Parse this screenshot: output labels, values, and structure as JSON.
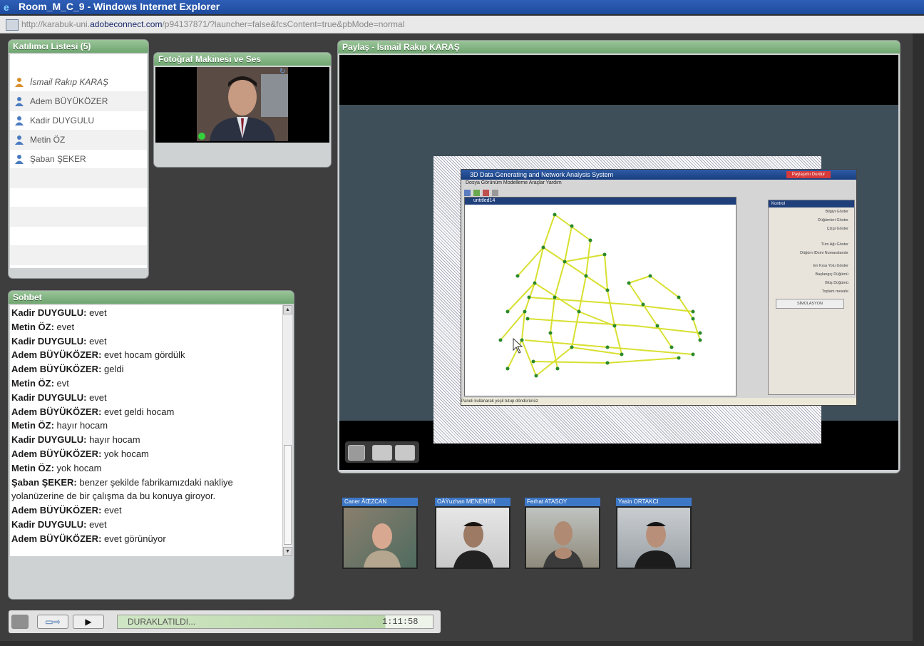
{
  "window": {
    "title": "Room_M_C_9 - Windows Internet Explorer",
    "url_prefix": "http://karabuk-uni.",
    "url_domain": "adobeconnect.com",
    "url_suffix": "/p94137871/?launcher=false&fcsContent=true&pbMode=normal"
  },
  "attendees": {
    "title": "Katılımcı Listesi (5)",
    "items": [
      {
        "name": "İsmail Rakıp KARAŞ"
      },
      {
        "name": "Adem BÜYÜKÖZER"
      },
      {
        "name": "Kadir DUYGULU"
      },
      {
        "name": "Metin ÖZ"
      },
      {
        "name": "Şaban ŞEKER"
      }
    ]
  },
  "camera": {
    "title": "Fotoğraf Makinesi ve Ses"
  },
  "share": {
    "title": "Paylaş - İsmail Rakıp KARAŞ",
    "app_title": "3D Data Generating and Network Analysis System",
    "app_menu": "Dosya  Görünüm  Modelleme  Araçlar  Yardım",
    "inner_title": "untitled14",
    "status": "Paneli kullanarak yeşil tutup döndürünüz",
    "panel_title": "Kontrol",
    "panel_items": [
      "Bilgiyi Göster",
      "Düğümleri Göster",
      "Çizgi Göster",
      "Tüm Ağı Göster",
      "Düğüm IDsini Numaralandır",
      "En Kısa Yolu Göster",
      "Başlangıç Düğümü",
      "Bitiş Düğümü",
      "Toplam mesafe",
      "SİMÜLASYON"
    ],
    "share_badge": "Paylaşımı Durdur"
  },
  "chat": {
    "title": "Sohbet",
    "messages": [
      {
        "sender": "Kadir DUYGULU:",
        "text": " evet"
      },
      {
        "sender": "Metin ÖZ:",
        "text": " evet"
      },
      {
        "sender": "Kadir DUYGULU:",
        "text": " evet"
      },
      {
        "sender": "Adem BÜYÜKÖZER:",
        "text": " evet hocam gördülk"
      },
      {
        "sender": "Adem BÜYÜKÖZER:",
        "text": " geldi"
      },
      {
        "sender": "Metin ÖZ:",
        "text": " evt"
      },
      {
        "sender": "Kadir DUYGULU:",
        "text": " evet"
      },
      {
        "sender": "Adem BÜYÜKÖZER:",
        "text": " evet geldi hocam"
      },
      {
        "sender": "Metin ÖZ:",
        "text": " hayır hocam"
      },
      {
        "sender": "Kadir DUYGULU:",
        "text": " hayır hocam"
      },
      {
        "sender": "Adem BÜYÜKÖZER:",
        "text": " yok hocam"
      },
      {
        "sender": "Metin ÖZ:",
        "text": " yok hocam"
      },
      {
        "sender": "Şaban ŞEKER:",
        "text": " benzer şekilde fabrikamızdaki nakliye"
      },
      {
        "sender": "",
        "text": "yolanüzerine de bir çalışma da bu konuya giroyor."
      },
      {
        "sender": "Adem BÜYÜKÖZER:",
        "text": " evet"
      },
      {
        "sender": "Kadir DUYGULU:",
        "text": " evet"
      },
      {
        "sender": "Adem BÜYÜKÖZER:",
        "text": " evet görünüyor"
      }
    ]
  },
  "videos": [
    {
      "name": "Caner ÃŒZCAN"
    },
    {
      "name": "OÄŸuzhan MENEMEN"
    },
    {
      "name": "Ferhat ATASOY"
    },
    {
      "name": "Yasin ORTAKCI"
    }
  ],
  "playback": {
    "status": "DURAKLATILDI...",
    "time": "1:11:58",
    "progress": 0.845
  },
  "colors": {
    "pod_header": "#7fb07f",
    "video_name_bar": "#3d78c7",
    "graph_edge": "#d8e030",
    "graph_node": "#2a8a2a"
  }
}
